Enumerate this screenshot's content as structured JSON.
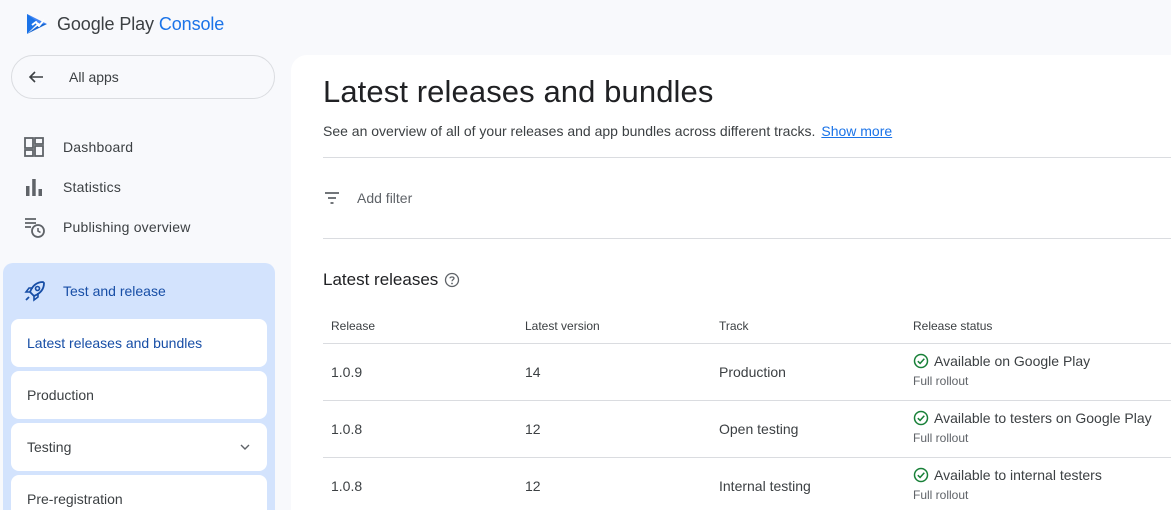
{
  "brand": {
    "name_part1": "Google Play",
    "name_part2": "Console",
    "accent_color": "#1a73e8"
  },
  "sidebar": {
    "all_apps_label": "All apps",
    "items": [
      {
        "label": "Dashboard",
        "icon": "dashboard-icon"
      },
      {
        "label": "Statistics",
        "icon": "bar-chart-icon"
      },
      {
        "label": "Publishing overview",
        "icon": "publishing-overview-icon"
      }
    ],
    "section": {
      "label": "Test and release",
      "icon": "rocket-icon",
      "sub_items": [
        {
          "label": "Latest releases and bundles",
          "active": true
        },
        {
          "label": "Production"
        },
        {
          "label": "Testing",
          "expandable": true
        },
        {
          "label": "Pre-registration"
        }
      ]
    }
  },
  "main": {
    "title": "Latest releases and bundles",
    "description": "See an overview of all of your releases and app bundles across different tracks.",
    "show_more": "Show more",
    "filter_label": "Add filter",
    "releases_title": "Latest releases",
    "table": {
      "headers": [
        "Release",
        "Latest version",
        "Track",
        "Release status"
      ],
      "rows": [
        {
          "release": "1.0.9",
          "version": "14",
          "track": "Production",
          "status": "Available on Google Play",
          "rollout": "Full rollout"
        },
        {
          "release": "1.0.8",
          "version": "12",
          "track": "Open testing",
          "status": "Available to testers on Google Play",
          "rollout": "Full rollout"
        },
        {
          "release": "1.0.8",
          "version": "12",
          "track": "Internal testing",
          "status": "Available to internal testers",
          "rollout": "Full rollout"
        }
      ]
    }
  },
  "colors": {
    "status_ok": "#188038",
    "section_bg": "#d3e3fd",
    "link": "#1a73e8"
  }
}
